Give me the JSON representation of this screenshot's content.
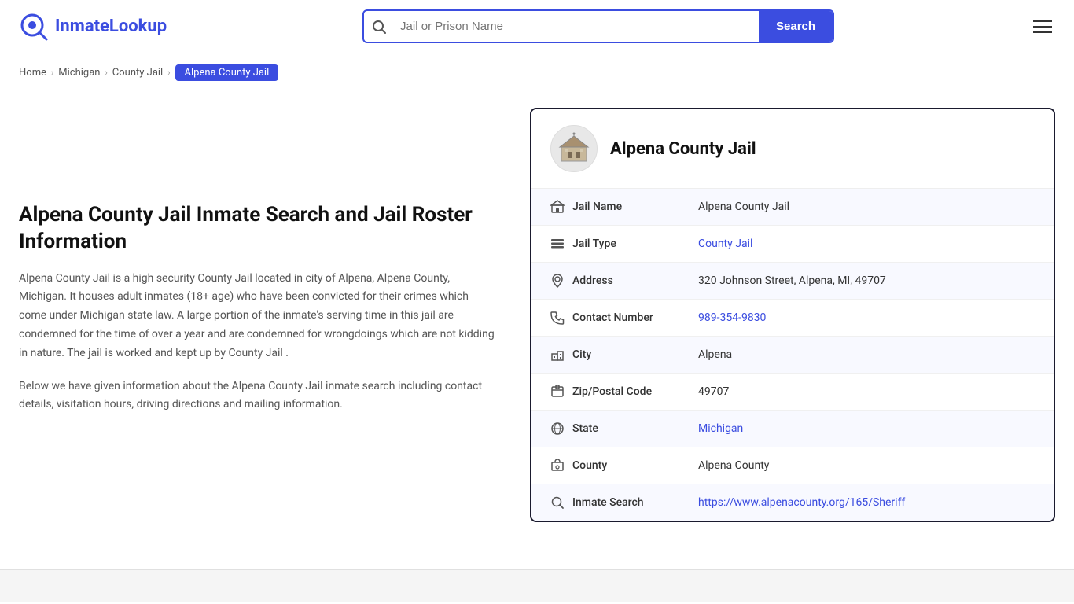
{
  "site": {
    "logo_name": "InmateLookup",
    "logo_name_part1": "Inmate",
    "logo_name_part2": "Lookup"
  },
  "header": {
    "search_placeholder": "Jail or Prison Name",
    "search_button_label": "Search"
  },
  "breadcrumb": {
    "items": [
      {
        "label": "Home",
        "href": "#"
      },
      {
        "label": "Michigan",
        "href": "#"
      },
      {
        "label": "County Jail",
        "href": "#"
      },
      {
        "label": "Alpena County Jail",
        "active": true
      }
    ]
  },
  "left": {
    "title": "Alpena County Jail Inmate Search and Jail Roster Information",
    "description1": "Alpena County Jail is a high security County Jail located in city of Alpena, Alpena County, Michigan. It houses adult inmates (18+ age) who have been convicted for their crimes which come under Michigan state law. A large portion of the inmate's serving time in this jail are condemned for the time of over a year and are condemned for wrongdoings which are not kidding in nature. The jail is worked and kept up by County Jail .",
    "description2": "Below we have given information about the Alpena County Jail inmate search including contact details, visitation hours, driving directions and mailing information."
  },
  "card": {
    "title": "Alpena County Jail",
    "rows": [
      {
        "icon": "jail-icon",
        "label": "Jail Name",
        "value": "Alpena County Jail",
        "link": null
      },
      {
        "icon": "list-icon",
        "label": "Jail Type",
        "value": "County Jail",
        "link": "#"
      },
      {
        "icon": "location-icon",
        "label": "Address",
        "value": "320 Johnson Street, Alpena, MI, 49707",
        "link": null
      },
      {
        "icon": "phone-icon",
        "label": "Contact Number",
        "value": "989-354-9830",
        "link": "tel:989-354-9830"
      },
      {
        "icon": "city-icon",
        "label": "City",
        "value": "Alpena",
        "link": null
      },
      {
        "icon": "zip-icon",
        "label": "Zip/Postal Code",
        "value": "49707",
        "link": null
      },
      {
        "icon": "globe-icon",
        "label": "State",
        "value": "Michigan",
        "link": "#"
      },
      {
        "icon": "county-icon",
        "label": "County",
        "value": "Alpena County",
        "link": null
      },
      {
        "icon": "search-icon",
        "label": "Inmate Search",
        "value": "https://www.alpenacounty.org/165/Sheriff",
        "link": "https://www.alpenacounty.org/165/Sheriff"
      }
    ]
  }
}
